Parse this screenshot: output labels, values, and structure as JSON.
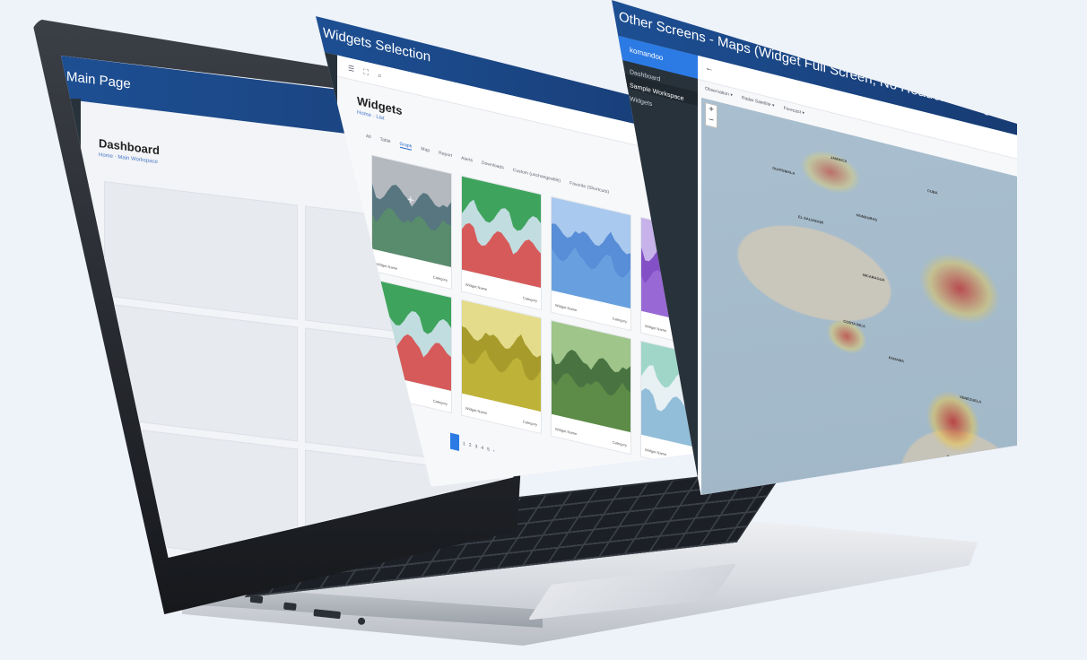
{
  "main_page": {
    "window_title": "Main Page",
    "page_title": "Dashboard",
    "breadcrumb": "Home · Main Workspace"
  },
  "widgets_window": {
    "window_title": "Widgets Selection",
    "heading": "Widgets",
    "breadcrumb": "Home · List",
    "tabs": [
      "All",
      "Table",
      "Graph",
      "Map",
      "Report",
      "Alerts",
      "Downloads",
      "Custom (unchangeable)",
      "Favorite (Shortcuts)"
    ],
    "active_tab": "Graph",
    "cards": [
      {
        "caption": "Widget Name",
        "category": "Category",
        "colors": [
          "#4d6f78",
          "#5a8f6a",
          "#b4b9c0"
        ]
      },
      {
        "caption": "Widget Name",
        "category": "Category",
        "colors": [
          "#cfe3ee",
          "#d94b4b",
          "#3ea35c"
        ]
      },
      {
        "caption": "Widget Name",
        "category": "Category",
        "colors": [
          "#4f86d4",
          "#6aa2e0",
          "#a9c9ee"
        ]
      },
      {
        "caption": "Widget Name",
        "category": "Category",
        "colors": [
          "#7b45c2",
          "#9a6bd6",
          "#c7b3ea"
        ]
      },
      {
        "caption": "Widget Name",
        "category": "Category",
        "colors": [
          "#cfe3ee",
          "#d94b4b",
          "#3ea35c"
        ]
      },
      {
        "caption": "Widget Name",
        "category": "Category",
        "colors": [
          "#9e9320",
          "#c2b53a",
          "#e4dc8a"
        ]
      },
      {
        "caption": "Widget Name",
        "category": "Category",
        "colors": [
          "#3f6a3a",
          "#5e8f48",
          "#9fc58a"
        ]
      },
      {
        "caption": "Widget Name",
        "category": "Category",
        "colors": [
          "#eef3f7",
          "#8ab8d6",
          "#9fd6c8"
        ]
      }
    ],
    "pager": [
      "1",
      "2",
      "3",
      "4",
      "5",
      "›"
    ]
  },
  "maps_window": {
    "window_title": "Other Screens - Maps (Widget Full Screen, No Header Settings)",
    "brand": "komandoo",
    "nav": [
      "Dashboard",
      "Sample Workspace",
      "Widgets"
    ],
    "active_nav": "Sample Workspace",
    "filters": [
      "Observation ▾",
      "Radar Satellite ▾",
      "Forecast ▾"
    ],
    "zoom_in": "+",
    "zoom_out": "−",
    "map_labels": [
      "GUATEMALA",
      "HONDURAS",
      "EL SALVADOR",
      "NICARAGUA",
      "COSTA RICA",
      "PANAMA",
      "VENEZUELA",
      "COLOMBIA",
      "JAMAICA",
      "CUBA"
    ]
  },
  "icons": [
    "home-icon",
    "menu-icon",
    "expand-icon",
    "search-icon",
    "back-arrow-icon",
    "plus-icon"
  ],
  "accent_color": "#1d4f93",
  "sidebar_color": "#28323b",
  "highlight_color": "#2c7be5"
}
